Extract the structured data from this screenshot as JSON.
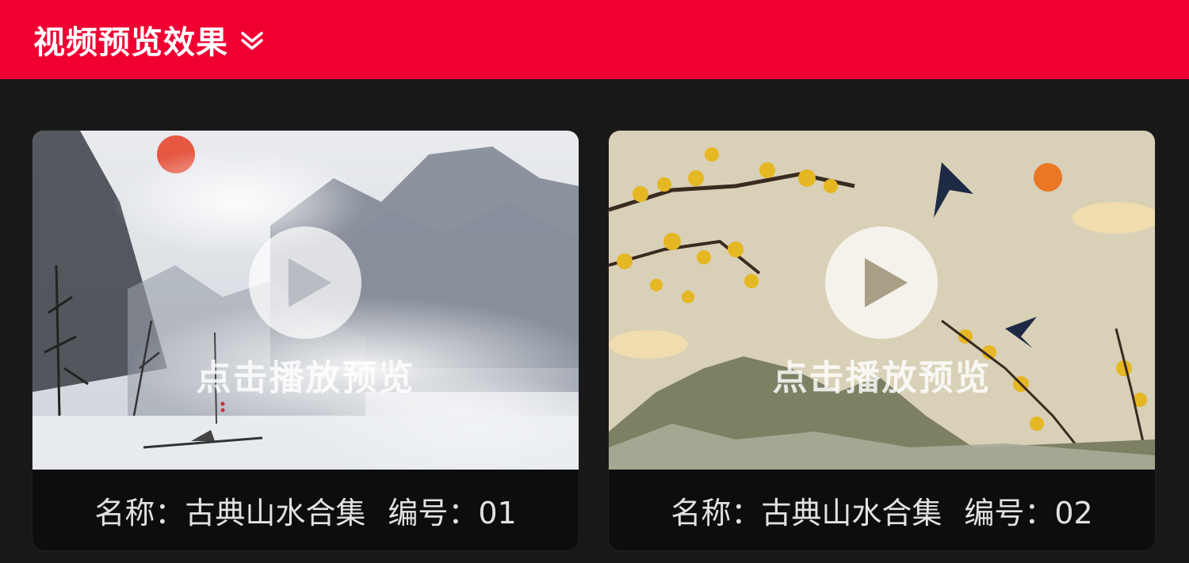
{
  "header": {
    "title": "视频预览效果",
    "chevron_icon": "double-chevron-down-icon",
    "background": "#f00032"
  },
  "cards": [
    {
      "play_icon": "play-icon",
      "overlay_text": "点击播放预览",
      "name": "名称：古典山水合集",
      "number": "编号：01"
    },
    {
      "play_icon": "play-icon",
      "overlay_text": "点击播放预览",
      "name": "名称：古典山水合集",
      "number": "编号：02"
    }
  ]
}
